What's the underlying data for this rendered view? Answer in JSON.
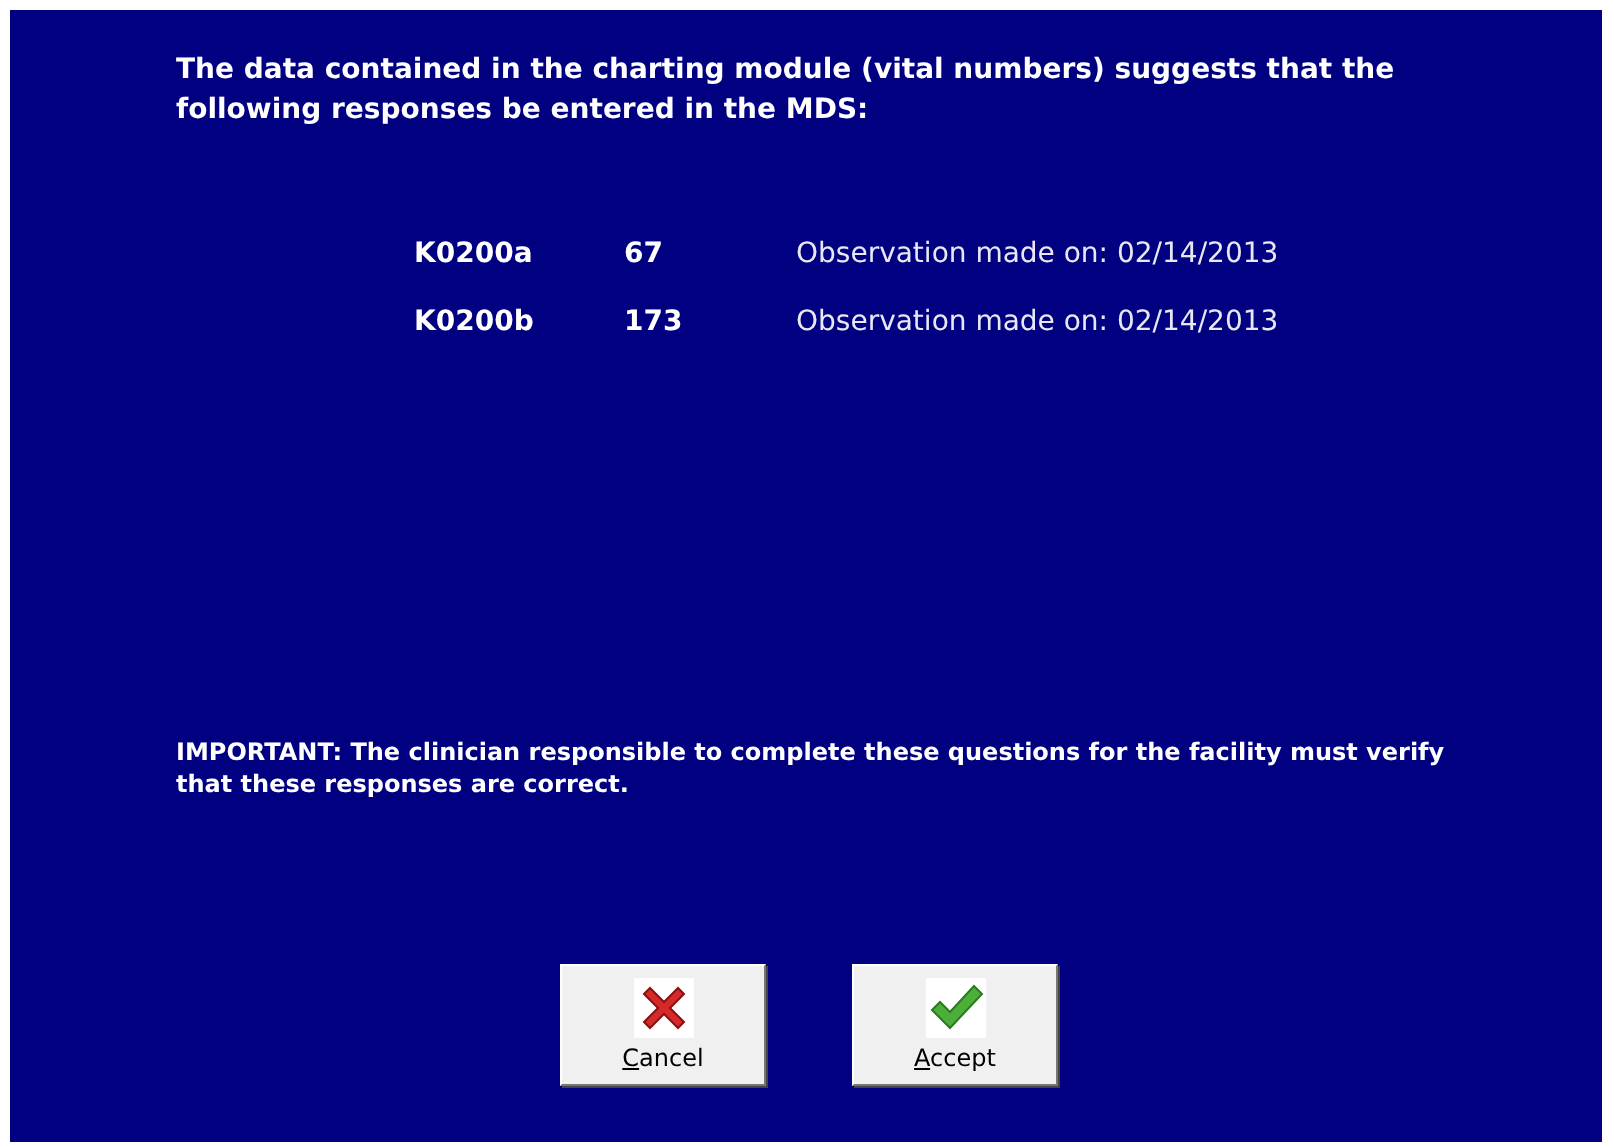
{
  "message": "The data contained in the charting module (vital numbers) suggests that the following responses be entered in the MDS:",
  "responses": [
    {
      "item": "K0200a",
      "value": "67",
      "observation": "Observation made on: 02/14/2013"
    },
    {
      "item": "K0200b",
      "value": "173",
      "observation": "Observation made on: 02/14/2013"
    }
  ],
  "notice": "IMPORTANT: The clinician responsible to complete these questions for the facility must verify that these responses are correct.",
  "buttons": [
    {
      "label": "Cancel",
      "kind": "cancel"
    },
    {
      "label": "Accept",
      "kind": "accept"
    }
  ]
}
